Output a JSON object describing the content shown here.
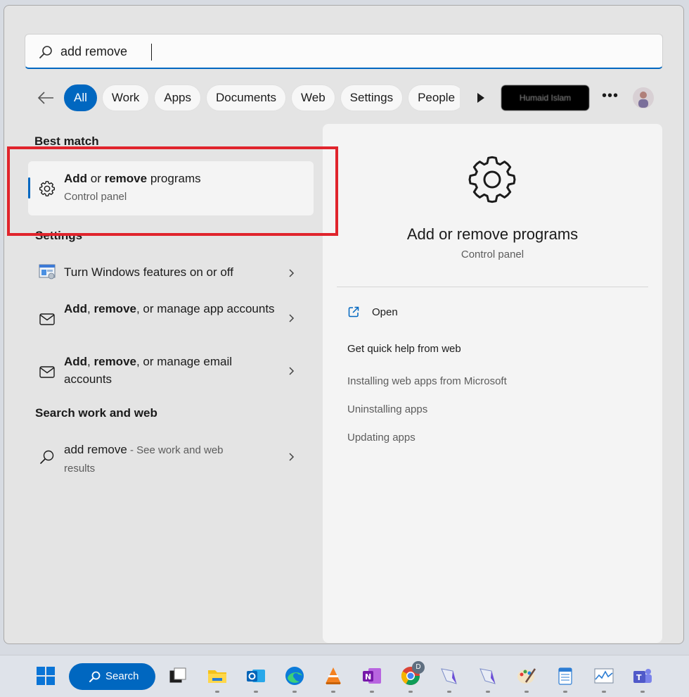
{
  "search": {
    "value": "add remove"
  },
  "filters": {
    "chips": [
      "All",
      "Work",
      "Apps",
      "Documents",
      "Web",
      "Settings",
      "People"
    ],
    "active": "All",
    "account_label": "Humaid Islam"
  },
  "best_match": {
    "section_title": "Best match",
    "title_bold_1": "Add",
    "title_mid": " or ",
    "title_bold_2": "remove",
    "title_end": " programs",
    "subtitle": "Control panel",
    "icon": "gear-icon"
  },
  "settings": {
    "section_title": "Settings",
    "items": [
      {
        "pre": "",
        "bold1": "",
        "mid": "Turn Windows features on or off",
        "bold2": "",
        "end": "",
        "icon": "windows-features-icon"
      },
      {
        "pre": "",
        "bold1": "Add",
        "mid": ", ",
        "bold2": "remove",
        "end": ", or manage app accounts",
        "icon": "mail-icon"
      },
      {
        "pre": "",
        "bold1": "Add",
        "mid": ", ",
        "bold2": "remove",
        "end": ", or manage email accounts",
        "icon": "mail-icon"
      }
    ]
  },
  "web": {
    "section_title": "Search work and web",
    "query": "add remove",
    "suffix": " - See work and web results"
  },
  "detail": {
    "title": "Add or remove programs",
    "subtitle": "Control panel",
    "open_label": "Open",
    "quick_help_title": "Get quick help from web",
    "help_links": [
      "Installing web apps from Microsoft",
      "Uninstalling apps",
      "Updating apps"
    ]
  },
  "taskbar": {
    "search_label": "Search",
    "apps": [
      "task-view",
      "file-explorer",
      "outlook",
      "edge",
      "vlc",
      "onenote",
      "chrome",
      "app-8",
      "app-9",
      "paint",
      "notepad",
      "perfmon",
      "teams"
    ],
    "chrome_profile_badge": "D"
  },
  "colors": {
    "accent": "#0067c0",
    "highlight": "#e0242c"
  }
}
